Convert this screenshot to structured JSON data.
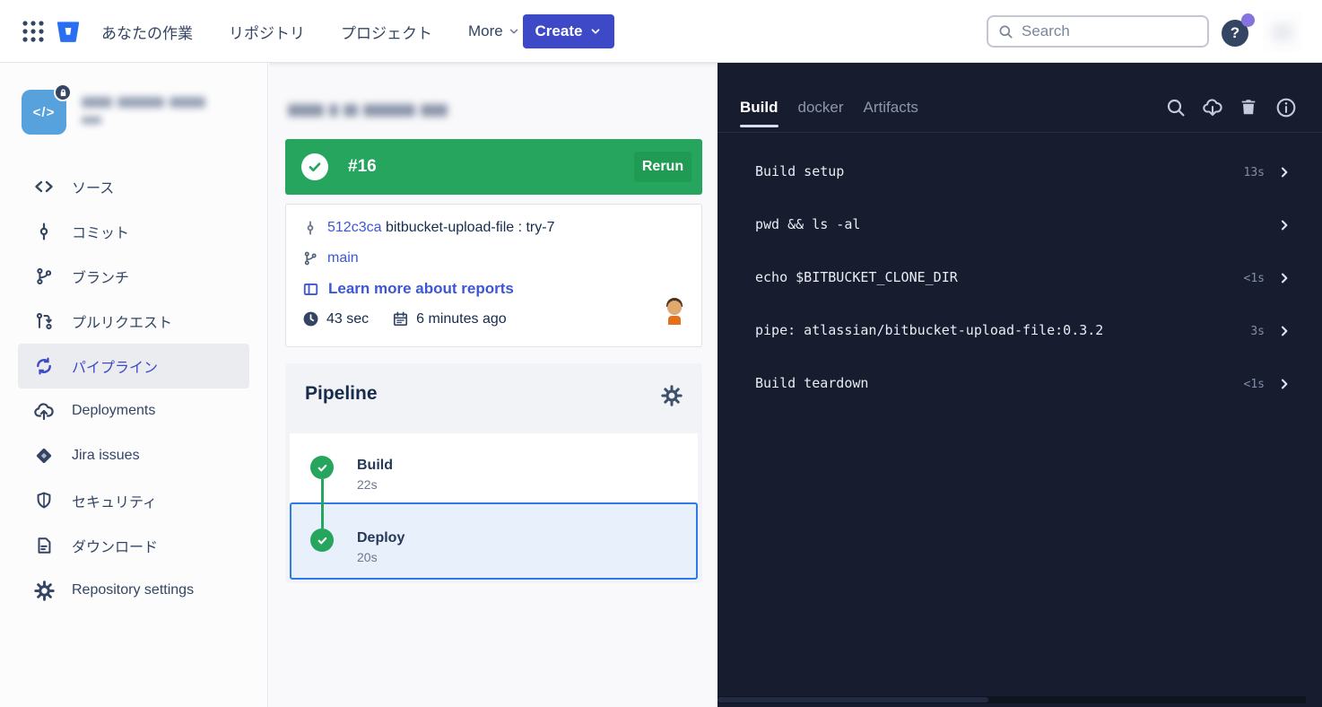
{
  "navbar": {
    "menu": [
      "あなたの作業",
      "リポジトリ",
      "プロジェクト",
      "More"
    ],
    "create_label": "Create",
    "search_placeholder": "Search",
    "help_label": "?"
  },
  "sidebar": {
    "repo_avatar_glyph": "</>",
    "items": [
      {
        "label": "ソース",
        "icon": "source-icon"
      },
      {
        "label": "コミット",
        "icon": "commit-icon"
      },
      {
        "label": "ブランチ",
        "icon": "branch-icon"
      },
      {
        "label": "プルリクエスト",
        "icon": "pull-request-icon"
      },
      {
        "label": "パイプライン",
        "icon": "pipelines-icon",
        "selected": true
      },
      {
        "label": "Deployments",
        "icon": "cloud-upload-icon"
      },
      {
        "label": "Jira issues",
        "icon": "jira-icon"
      },
      {
        "label": "セキュリティ",
        "icon": "shield-icon"
      },
      {
        "label": "ダウンロード",
        "icon": "document-icon"
      },
      {
        "label": "Repository settings",
        "icon": "gear-icon"
      }
    ]
  },
  "run": {
    "number": "#16",
    "status": "success",
    "rerun_label": "Rerun",
    "commit_hash": "512c3ca",
    "commit_message": "bitbucket-upload-file : try-7",
    "branch": "main",
    "reports_link": "Learn more about reports",
    "duration": "43 sec",
    "time_ago": "6 minutes ago"
  },
  "pipeline": {
    "title": "Pipeline",
    "steps": [
      {
        "name": "Build",
        "duration": "22s",
        "status": "success"
      },
      {
        "name": "Deploy",
        "duration": "20s",
        "status": "success",
        "selected": true
      }
    ]
  },
  "log_panel": {
    "tabs": [
      "Build",
      "docker",
      "Artifacts"
    ],
    "active_tab": "Build",
    "rows": [
      {
        "label": "Build setup",
        "duration": "13s"
      },
      {
        "label": "pwd && ls -al",
        "duration": ""
      },
      {
        "label": "echo $BITBUCKET_CLONE_DIR",
        "duration": "<1s"
      },
      {
        "label": "pipe: atlassian/bitbucket-upload-file:0.3.2",
        "duration": "3s"
      },
      {
        "label": "Build teardown",
        "duration": "<1s"
      }
    ]
  },
  "icons": {
    "app-grid-icon": "nine-dots",
    "bitbucket-logo": "bucket",
    "chevron-down-icon": "chevron-down",
    "search-icon": "magnifier",
    "help-icon": "question-mark",
    "lock-icon": "padlock",
    "source-icon": "angle-brackets",
    "commit-icon": "commit-node",
    "branch-icon": "git-branch",
    "pull-request-icon": "git-pull-request",
    "pipelines-icon": "sync-arrows",
    "cloud-upload-icon": "cloud-up-arrow",
    "jira-icon": "jira-diamond",
    "shield-icon": "shield",
    "document-icon": "page-lines",
    "gear-icon": "gear",
    "check-icon": "checkmark",
    "clock-icon": "clock",
    "calendar-icon": "calendar",
    "reports-icon": "layout-panel",
    "cloud-download-icon": "cloud-down-arrow",
    "trash-icon": "trash-can",
    "info-icon": "info-circle",
    "chevron-right-icon": "chevron-right"
  },
  "colors": {
    "accent": "#3d49c6",
    "link": "#3d56d6",
    "success-green": "#26a55e",
    "rerun-green": "#1f9b53",
    "panel-bg": "#171c2f",
    "selected-row-bg": "#e8f0fc",
    "selected-row-border": "#2f7ae8",
    "avatar-blue": "#57a1dc",
    "help-dot": "#8673dd",
    "nav-ink": "#344563"
  }
}
